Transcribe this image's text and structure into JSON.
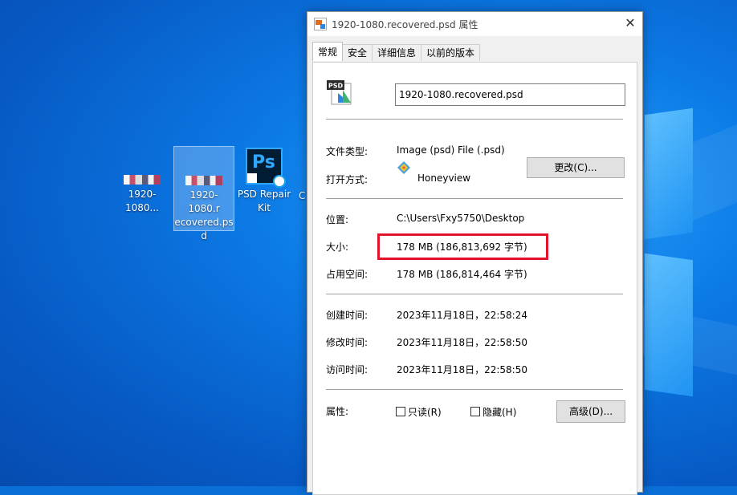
{
  "desktop": {
    "icons": [
      {
        "label": "1920-1080...",
        "kind": "psd-thumb"
      },
      {
        "label": "1920-1080.recovered.psd",
        "line1": "1920-1080.r",
        "line2": "ecovered.ps",
        "line3": "d",
        "kind": "psd-thumb",
        "selected": true
      },
      {
        "label": "PSD Repair Kit",
        "line1": "PSD Repair",
        "line2": "Kit",
        "kind": "photoshop"
      },
      {
        "label": "C",
        "kind": "partial"
      }
    ]
  },
  "dialog": {
    "title": "1920-1080.recovered.psd 属性",
    "close_glyph": "✕",
    "tabs": [
      {
        "label": "常规",
        "active": true
      },
      {
        "label": "安全"
      },
      {
        "label": "详细信息"
      },
      {
        "label": "以前的版本"
      }
    ],
    "filename": "1920-1080.recovered.psd",
    "file_type_label": "文件类型:",
    "file_type_value": "Image (psd) File (.psd)",
    "open_with_label": "打开方式:",
    "open_with_value": "Honeyview",
    "change_button": "更改(C)...",
    "location_label": "位置:",
    "location_value": "C:\\Users\\Fxy5750\\Desktop",
    "size_label": "大小:",
    "size_value": "178 MB (186,813,692 字节)",
    "size_on_disk_label": "占用空间:",
    "size_on_disk_value": "178 MB (186,814,464 字节)",
    "created_label": "创建时间:",
    "created_value": "2023年11月18日，22:58:24",
    "modified_label": "修改时间:",
    "modified_value": "2023年11月18日，22:58:50",
    "accessed_label": "访问时间:",
    "accessed_value": "2023年11月18日，22:58:50",
    "attributes_label": "属性:",
    "readonly_label": "只读(R)",
    "hidden_label": "隐藏(H)",
    "advanced_button": "高级(D)...",
    "psd_icon_text": "PSD",
    "highlight_color": "#e3122b"
  }
}
